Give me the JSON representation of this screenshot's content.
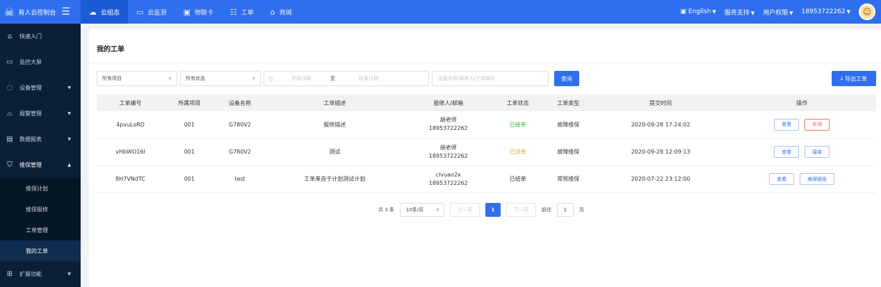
{
  "brand": {
    "logo_icon": "person-logo-icon",
    "title": "有人云控制台",
    "menu_icon": "hamburger-icon"
  },
  "topnav": [
    {
      "label": "云组态",
      "icon": "cloud-icon",
      "active": true
    },
    {
      "label": "云监测",
      "icon": "monitor-icon",
      "active": false
    },
    {
      "label": "物联卡",
      "icon": "card-icon",
      "active": false
    },
    {
      "label": "工单",
      "icon": "ticket-icon",
      "active": false
    },
    {
      "label": "商城",
      "icon": "shop-icon",
      "active": false
    }
  ],
  "topright": {
    "language": "English",
    "support": "服务支持",
    "permissions": "用户权限",
    "user": "18953722262"
  },
  "sidebar": {
    "items": [
      {
        "label": "快速入门",
        "icon": "home-icon"
      },
      {
        "label": "监控大屏",
        "icon": "screen-icon"
      },
      {
        "label": "设备管理",
        "icon": "device-icon"
      },
      {
        "label": "报警管理",
        "icon": "bell-icon"
      },
      {
        "label": "数据报表",
        "icon": "report-icon"
      },
      {
        "label": "维保管理",
        "icon": "shield-icon"
      }
    ],
    "sub": [
      "维保计划",
      "维保报修",
      "工单管理",
      "我的工单"
    ],
    "extra": {
      "label": "扩展功能",
      "icon": "grid-icon"
    }
  },
  "page": {
    "title": "我的工单"
  },
  "filters": {
    "project": "所有项目",
    "status": "所有状态",
    "start_date": "开始日期",
    "date_sep": "至",
    "end_date": "结束日期",
    "keyword_placeholder": "设备名称/报修人/工单编号",
    "search": "查询",
    "export": "导出工单"
  },
  "table": {
    "headers": [
      "工单编号",
      "所属项目",
      "设备名称",
      "工单描述",
      "报修人/邮箱",
      "工单状态",
      "工单类型",
      "提交时间",
      "操作"
    ],
    "rows": [
      {
        "id": "4pvuLoRD",
        "project": "001",
        "device": "G780V2",
        "desc": "报修描述",
        "reporter": "胡老师",
        "phone": "18953722262",
        "status": "已接单",
        "status_color": "#35b845",
        "type": "故障维保",
        "time": "2020-09-28 17:24:02",
        "op1": "查看",
        "op2": "处理"
      },
      {
        "id": "vHbWO16I",
        "project": "001",
        "device": "G780V2",
        "desc": "测试",
        "reporter": "胡老师",
        "phone": "18953722262",
        "status": "已派单",
        "status_color": "#f39c34",
        "type": "故障维保",
        "time": "2020-09-28 12:09:13",
        "op1": "查看",
        "op2": "接单"
      },
      {
        "id": "8H7VNdTC",
        "project": "001",
        "device": "test",
        "desc": "工单来自于计划测试计划",
        "reporter": "clvuao2x",
        "phone": "18953722262",
        "status": "已结单",
        "status_color": "#333333",
        "type": "常规维保",
        "time": "2020-07-22 23:12:00",
        "op1": "查看",
        "op2": "维保报告"
      }
    ]
  },
  "pager": {
    "total": "共 3 条",
    "size": "10条/页",
    "prev": "上一页",
    "current": "1",
    "next": "下一页",
    "goto": "前往",
    "goto_value": "1",
    "page_unit": "页"
  }
}
